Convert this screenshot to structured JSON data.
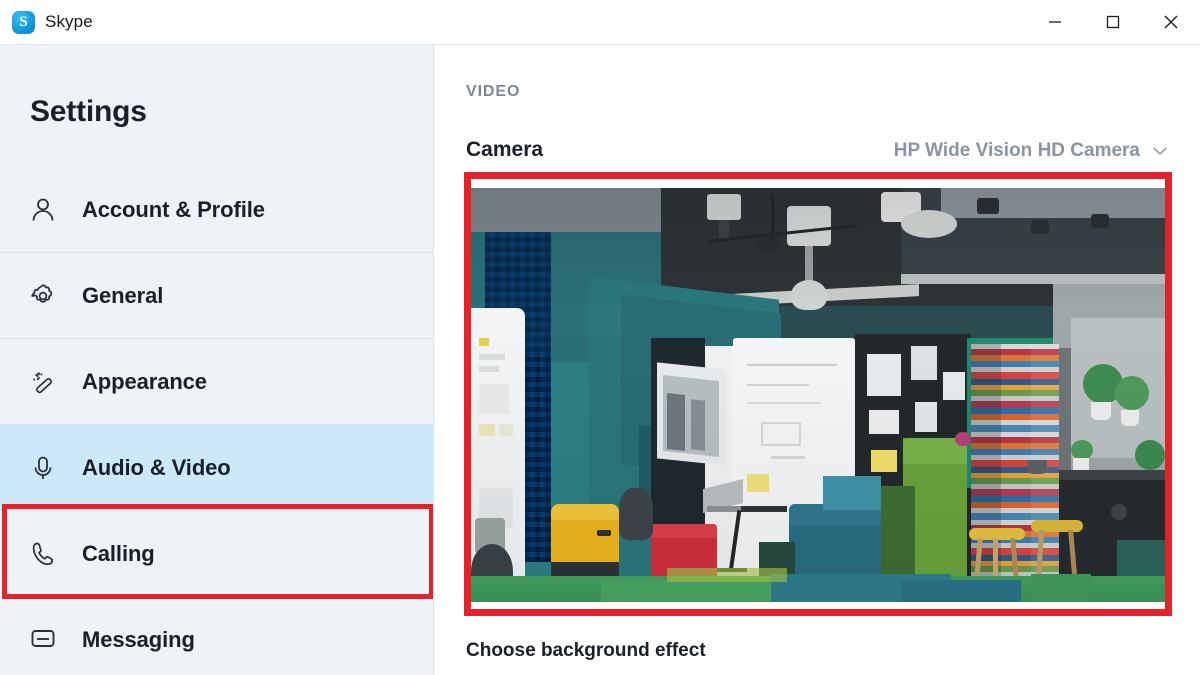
{
  "window": {
    "app_name": "Skype",
    "logo_glyph": "S",
    "controls": {
      "minimize_label": "Minimize",
      "maximize_label": "Maximize",
      "close_label": "Close"
    }
  },
  "sidebar": {
    "title": "Settings",
    "items": [
      {
        "label": "Account & Profile",
        "icon": "person-icon",
        "selected": false
      },
      {
        "label": "General",
        "icon": "gear-icon",
        "selected": false
      },
      {
        "label": "Appearance",
        "icon": "magic-wand-icon",
        "selected": false
      },
      {
        "label": "Audio & Video",
        "icon": "microphone-icon",
        "selected": true
      },
      {
        "label": "Calling",
        "icon": "phone-icon",
        "selected": false
      },
      {
        "label": "Messaging",
        "icon": "message-icon",
        "selected": false
      }
    ]
  },
  "content": {
    "section_label": "VIDEO",
    "camera_label": "Camera",
    "camera_device": "HP Wide Vision HD Camera",
    "camera_chevron": "chevron-down-icon",
    "background_effect_label": "Choose background effect",
    "preview_alt": "Live camera preview of a modern open-plan office interior"
  },
  "annotations": {
    "highlight_color": "#e3222a",
    "targets": [
      "audio-video-sidebar-item",
      "camera-preview"
    ]
  },
  "colors": {
    "sidebar_bg": "#eff2f7",
    "selected_item_bg": "#cbe9f8",
    "text_primary": "#1a2029",
    "text_muted": "#8b949f",
    "accent_red": "#e3222a",
    "skype_blue": "#18a4e0"
  }
}
